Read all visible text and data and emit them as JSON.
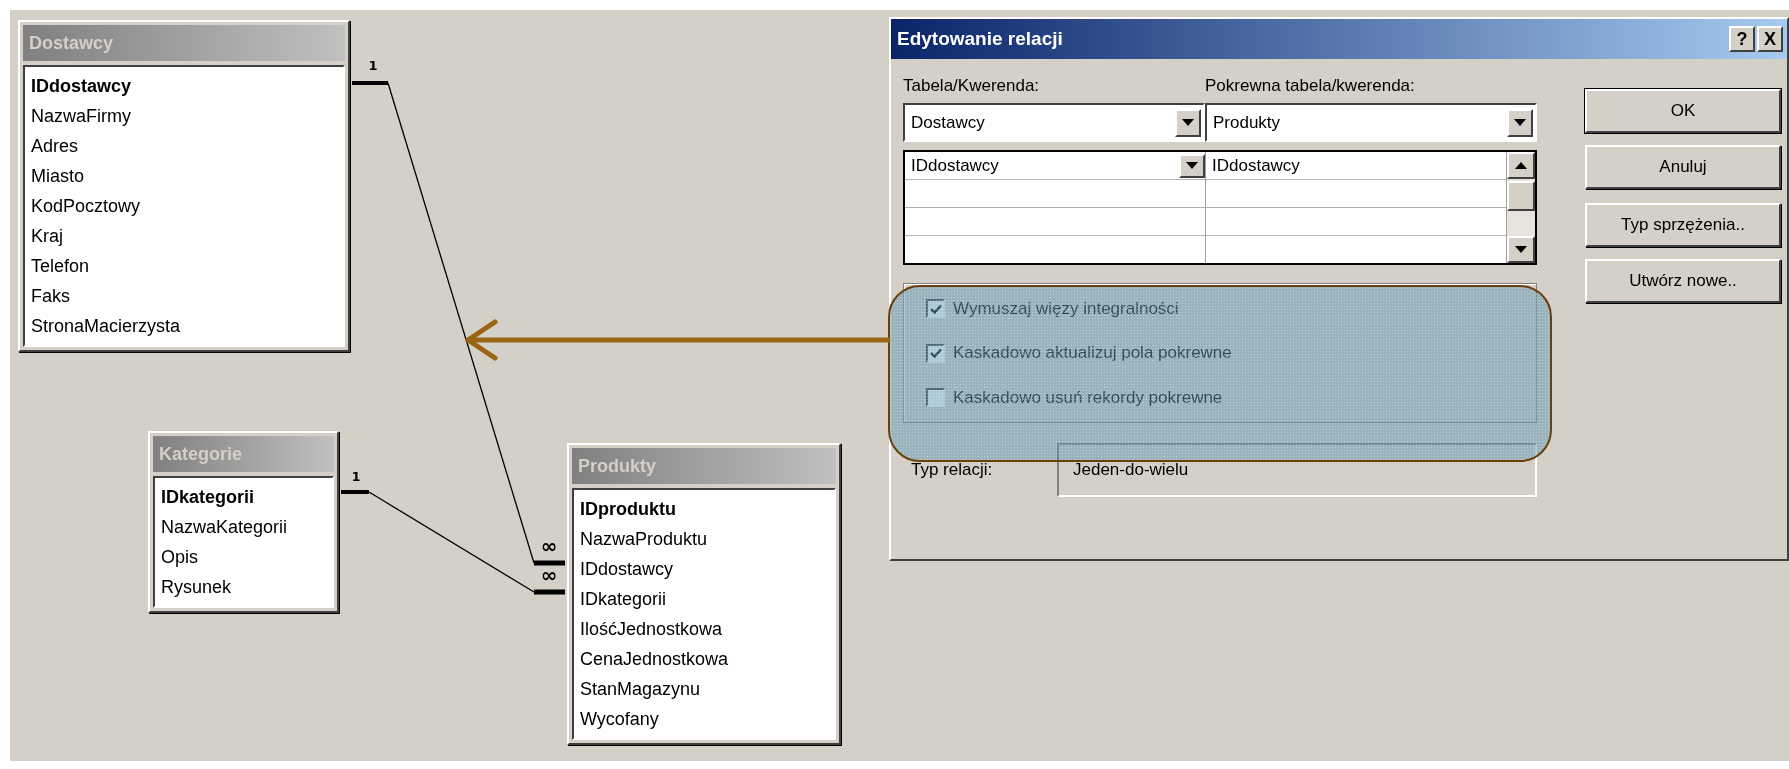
{
  "tables": [
    {
      "title": "Dostawcy",
      "fields": [
        {
          "name": "IDdostawcy",
          "primary_key": true
        },
        {
          "name": "NazwaFirmy",
          "primary_key": false
        },
        {
          "name": "Adres",
          "primary_key": false
        },
        {
          "name": "Miasto",
          "primary_key": false
        },
        {
          "name": "KodPocztowy",
          "primary_key": false
        },
        {
          "name": "Kraj",
          "primary_key": false
        },
        {
          "name": "Telefon",
          "primary_key": false
        },
        {
          "name": "Faks",
          "primary_key": false
        },
        {
          "name": "StronaMacierzysta",
          "primary_key": false
        }
      ]
    },
    {
      "title": "Kategorie",
      "fields": [
        {
          "name": "IDkategorii",
          "primary_key": true
        },
        {
          "name": "NazwaKategorii",
          "primary_key": false
        },
        {
          "name": "Opis",
          "primary_key": false
        },
        {
          "name": "Rysunek",
          "primary_key": false
        }
      ]
    },
    {
      "title": "Produkty",
      "fields": [
        {
          "name": "IDproduktu",
          "primary_key": true
        },
        {
          "name": "NazwaProduktu",
          "primary_key": false
        },
        {
          "name": "IDdostawcy",
          "primary_key": false
        },
        {
          "name": "IDkategorii",
          "primary_key": false
        },
        {
          "name": "IlośćJednostkowa",
          "primary_key": false
        },
        {
          "name": "CenaJednostkowa",
          "primary_key": false
        },
        {
          "name": "StanMagazynu",
          "primary_key": false
        },
        {
          "name": "Wycofany",
          "primary_key": false
        }
      ]
    }
  ],
  "relationships": [
    {
      "one_label": "1",
      "many_label": "∞"
    },
    {
      "one_label": "1",
      "many_label": "∞"
    }
  ],
  "dialog": {
    "title": "Edytowanie relacji",
    "help_button": "?",
    "close_button": "X",
    "table_label": "Tabela/Kwerenda:",
    "related_label": "Pokrewna tabela/kwerenda:",
    "table_value": "Dostawcy",
    "related_value": "Produkty",
    "field_rows": [
      {
        "left": "IDdostawcy",
        "right": "IDdostawcy"
      }
    ],
    "options": [
      {
        "label": "Wymuszaj więzy integralności",
        "checked": true
      },
      {
        "label": "Kaskadowo aktualizuj pola pokrewne",
        "checked": true
      },
      {
        "label": "Kaskadowo usuń rekordy pokrewne",
        "checked": false
      }
    ],
    "buttons": [
      "OK",
      "Anuluj",
      "Typ sprzężenia..",
      "Utwórz nowe.."
    ],
    "relation_type_label": "Typ relacji:",
    "relation_type_value": "Jeden-do-wielu"
  }
}
